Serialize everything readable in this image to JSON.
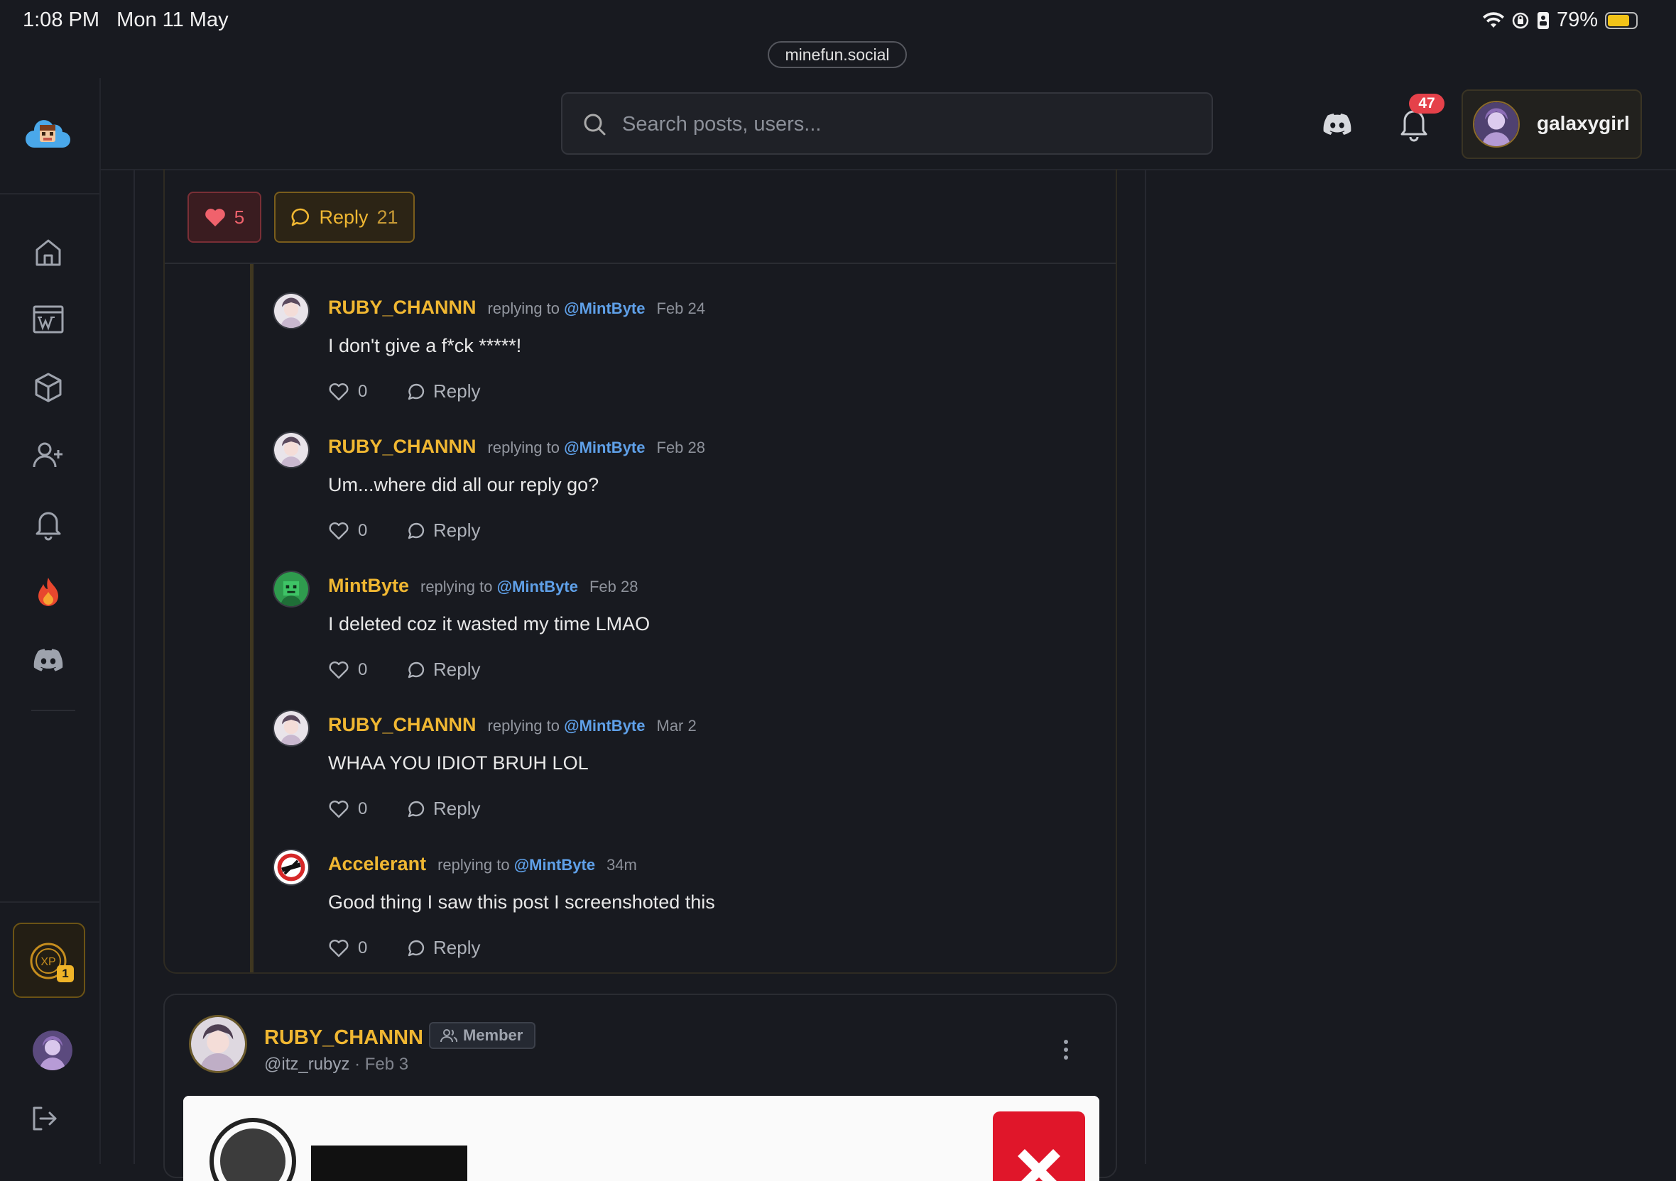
{
  "status_bar": {
    "time": "1:08 PM",
    "date": "Mon 11 May",
    "battery_percent": "79%",
    "battery_level": 0.79
  },
  "browser": {
    "url": "minefun.social"
  },
  "header": {
    "search_placeholder": "Search posts, users...",
    "notification_count": "47",
    "username": "galaxygirl"
  },
  "sidebar": {
    "items": [
      "home",
      "wiki",
      "items",
      "add-friend",
      "notifications",
      "trending",
      "discord"
    ],
    "xp_level": "1"
  },
  "post": {
    "like_count": "5",
    "reply_label": "Reply",
    "reply_count": "21"
  },
  "comments": [
    {
      "author": "RUBY_CHANNN",
      "replying_prefix": "replying to",
      "mention": "@MintByte",
      "date": "Feb 24",
      "text": "I don't give a f*ck *****!",
      "likes": "0",
      "reply_label": "Reply"
    },
    {
      "author": "RUBY_CHANNN",
      "replying_prefix": "replying to",
      "mention": "@MintByte",
      "date": "Feb 28",
      "text": "Um...where did all our reply go?",
      "likes": "0",
      "reply_label": "Reply"
    },
    {
      "author": "MintByte",
      "replying_prefix": "replying to",
      "mention": "@MintByte",
      "date": "Feb 28",
      "text": "I deleted coz it wasted my time LMAO",
      "likes": "0",
      "reply_label": "Reply"
    },
    {
      "author": "RUBY_CHANNN",
      "replying_prefix": "replying to",
      "mention": "@MintByte",
      "date": "Mar 2",
      "text": "WHAA YOU IDIOT BRUH LOL",
      "likes": "0",
      "reply_label": "Reply"
    },
    {
      "author": "Accelerant",
      "replying_prefix": "replying to",
      "mention": "@MintByte",
      "date": "34m",
      "text": "Good thing I saw this post I screenshoted this",
      "likes": "0",
      "reply_label": "Reply"
    }
  ],
  "next_post": {
    "author": "RUBY_CHANNN",
    "role": "Member",
    "handle": "@itz_rubyz",
    "separator": "·",
    "date": "Feb 3"
  },
  "colors": {
    "background": "#181a20",
    "accent_gold": "#f0b732",
    "like_red": "#f0626c",
    "mention_blue": "#5fa0e8"
  }
}
